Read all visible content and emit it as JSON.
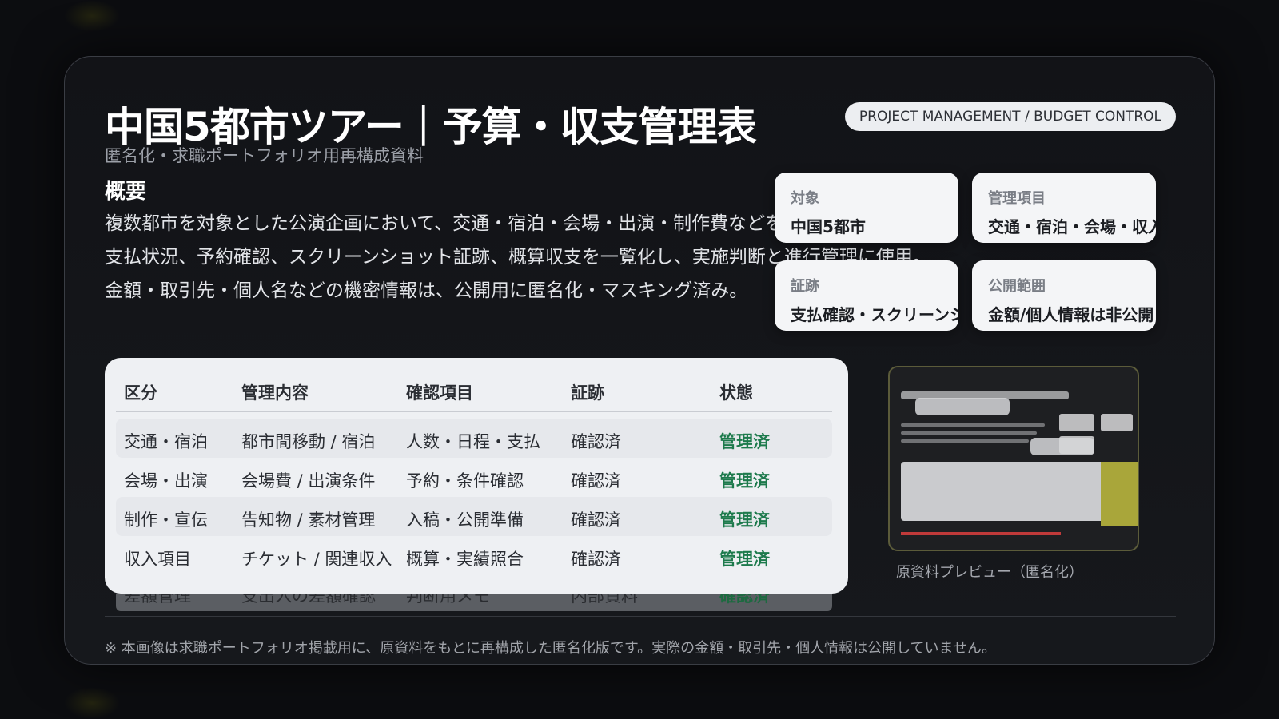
{
  "header": {
    "title": "中国5都市ツアー｜予算・収支管理表",
    "subtitle": "匿名化・求職ポートフォリオ用再構成資料",
    "badge": "PROJECT MANAGEMENT / BUDGET CONTROL"
  },
  "overview": {
    "heading": "概要",
    "lines": [
      "複数都市を対象とした公演企画において、交通・宿泊・会場・出演・制作費などを整理。",
      "支払状況、予約確認、スクリーンショット証跡、概算収支を一覧化し、実施判断と進行管理に使用。",
      "金額・取引先・個人名などの機密情報は、公開用に匿名化・マスキング済み。"
    ]
  },
  "info_cards": [
    {
      "label": "対象",
      "value": "中国5都市"
    },
    {
      "label": "管理項目",
      "value": "交通・宿泊・会場・収入"
    },
    {
      "label": "証跡",
      "value": "支払確認・スクリーンショット"
    },
    {
      "label": "公開範囲",
      "value": "金額/個人情報は非公開"
    }
  ],
  "table": {
    "headers": [
      "区分",
      "管理内容",
      "確認項目",
      "証跡",
      "状態"
    ],
    "rows": [
      [
        "交通・宿泊",
        "都市間移動 / 宿泊",
        "人数・日程・支払",
        "確認済",
        "管理済"
      ],
      [
        "会場・出演",
        "会場費 / 出演条件",
        "予約・条件確認",
        "確認済",
        "管理済"
      ],
      [
        "制作・宣伝",
        "告知物 / 素材管理",
        "入稿・公開準備",
        "確認済",
        "管理済"
      ],
      [
        "収入項目",
        "チケット / 関連収入",
        "概算・実績照合",
        "確認済",
        "管理済"
      ]
    ],
    "overflow_row": [
      "差額管理",
      "支出入の差額確認",
      "判断用メモ",
      "内部資料",
      "確認済"
    ]
  },
  "preview": {
    "caption": "原資料プレビュー（匿名化）"
  },
  "footnote": "※ 本画像は求職ポートフォリオ掲載用に、原資料をもとに再構成した匿名化版です。実際の金額・取引先・個人情報は公開していません。",
  "colors": {
    "background": "#0c0d10",
    "status_green": "#1d7a4c",
    "card_light": "#f4f5f7"
  }
}
